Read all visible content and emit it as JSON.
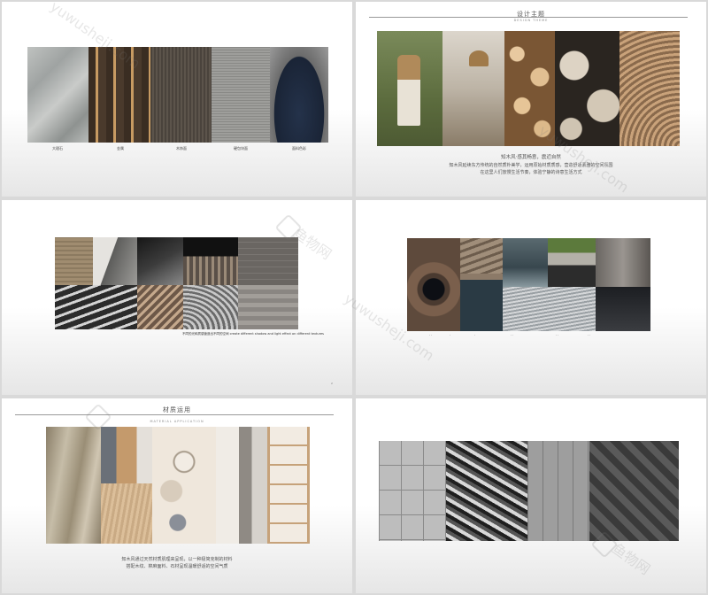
{
  "slides": {
    "s1": {
      "captions": [
        "大理石",
        "金属",
        "木饰面",
        "硬包块面",
        "面料色彩"
      ]
    },
    "s2": {
      "title": "设计主题",
      "subtitle": "DESIGN THEME",
      "line1": "知木风·感其畅意，震近自然",
      "line2": "知木风延续东方传统的自然质朴美学，运用原始材质质感，营造舒适素雅的空间氛围",
      "line3": "在这里人们放慢生活节奏，体验宁静的诗意生活方式"
    },
    "s3": {
      "note": "不同的光和质感营造出不同的空间 create different shadow and light effect on different textures",
      "page": "2"
    },
    "s4": {
      "labels": [
        "· ·",
        "·",
        "·",
        "· ·",
        "· ·",
        "· ·"
      ]
    },
    "s5": {
      "title": "材质运用",
      "subtitle": "MATERIAL APPLICATION",
      "line1": "知木风通过天然材质肌理来呈现，以一种极简克制的材料",
      "line2": "搭配木纹、棉麻面料、石材呈现温暖舒适的空间气质"
    }
  },
  "watermark": {
    "text": "yuwusheji.com",
    "brand": "鱼物网"
  }
}
